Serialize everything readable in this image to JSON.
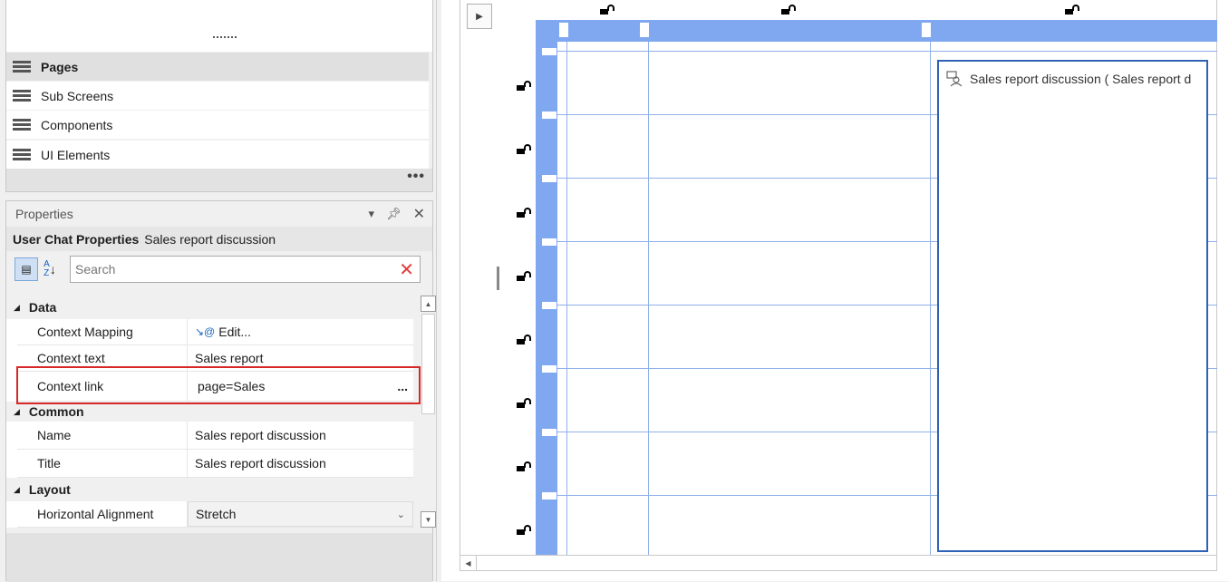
{
  "explorer": {
    "items": [
      {
        "label": "Pages",
        "active": true
      },
      {
        "label": "Sub Screens",
        "active": false
      },
      {
        "label": "Components",
        "active": false
      },
      {
        "label": "UI Elements",
        "active": false
      }
    ],
    "more_label": "•••"
  },
  "properties": {
    "panel_title": "Properties",
    "header_type": "User Chat Properties",
    "header_object": "Sales report discussion",
    "search_placeholder": "Search",
    "categories": {
      "data": "Data",
      "common": "Common",
      "layout": "Layout"
    },
    "rows": {
      "context_mapping": {
        "name": "Context Mapping",
        "value": "Edit..."
      },
      "context_text": {
        "name": "Context text",
        "value": "Sales report"
      },
      "context_link": {
        "name": "Context link",
        "value": "page=Sales",
        "button": "..."
      },
      "name": {
        "name": "Name",
        "value": "Sales report discussion"
      },
      "title": {
        "name": "Title",
        "value": "Sales report discussion"
      },
      "horizontal_alignment": {
        "name": "Horizontal Alignment",
        "value": "Stretch"
      }
    }
  },
  "designer": {
    "chat_control_label": "Sales report discussion ( Sales report d"
  },
  "colors": {
    "grid_accent": "#7fa8f0",
    "selection_border": "#2f62b5",
    "highlight": "#d62828"
  }
}
